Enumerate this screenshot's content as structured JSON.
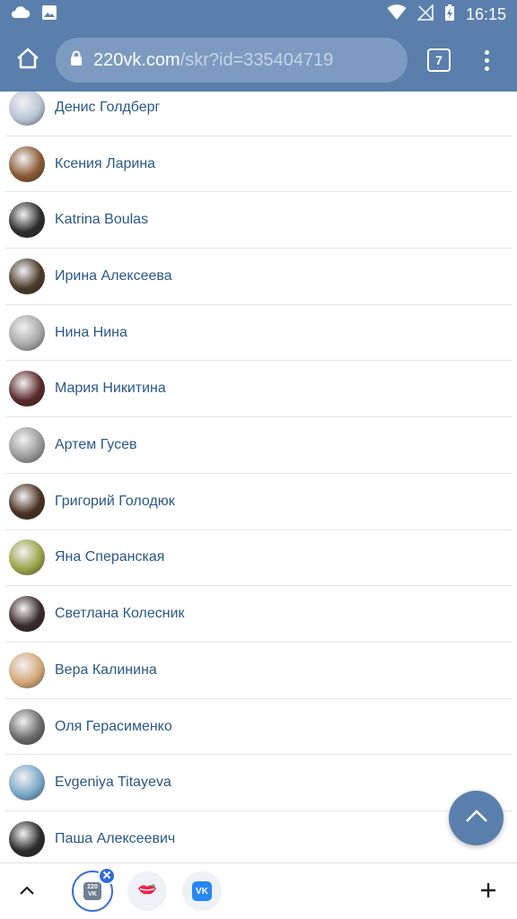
{
  "status_bar": {
    "time": "16:15",
    "icons": [
      "cloud-icon",
      "image-icon",
      "wifi-icon",
      "signal-icon",
      "battery-charging-icon"
    ]
  },
  "browser": {
    "url_host": "220vk.com",
    "url_path": "/skr?id=335404719",
    "tab_count": "7",
    "icons": [
      "home-icon",
      "lock-icon",
      "tabs-icon",
      "menu-icon"
    ]
  },
  "friends": [
    {
      "name": "Денис Голдберг",
      "avatar_color": "#b8c4d4"
    },
    {
      "name": "Ксения Ларина",
      "avatar_color": "#8a5a34"
    },
    {
      "name": "Katrina Boulas",
      "avatar_color": "#2c2c2c"
    },
    {
      "name": "Ирина Алексеева",
      "avatar_color": "#4a3a2a"
    },
    {
      "name": "Нина Нина",
      "avatar_color": "#a8a8a8"
    },
    {
      "name": "Мария Никитина",
      "avatar_color": "#5a2a2a"
    },
    {
      "name": "Артем Гусев",
      "avatar_color": "#9a9a9a"
    },
    {
      "name": "Григорий Голодюк",
      "avatar_color": "#4a3020"
    },
    {
      "name": "Яна Сперанская",
      "avatar_color": "#9aa44a"
    },
    {
      "name": "Светлана Колесник",
      "avatar_color": "#3a2a2a"
    },
    {
      "name": "Вера Калинина",
      "avatar_color": "#d4a878"
    },
    {
      "name": "Оля Герасименко",
      "avatar_color": "#6a6a6a"
    },
    {
      "name": "Evgeniya Titayeva",
      "avatar_color": "#7aa8c8"
    },
    {
      "name": "Паша Алексеевич",
      "avatar_color": "#2a2a2a"
    }
  ],
  "bottom_bar": {
    "active_app_label": "220 VK",
    "vk_label": "VK",
    "icons": [
      "chevron-up-icon",
      "close-icon",
      "lips-icon",
      "plus-icon"
    ]
  },
  "colors": {
    "header": "#5a7fad",
    "link": "#2a5885",
    "accent": "#2e6bd8"
  }
}
